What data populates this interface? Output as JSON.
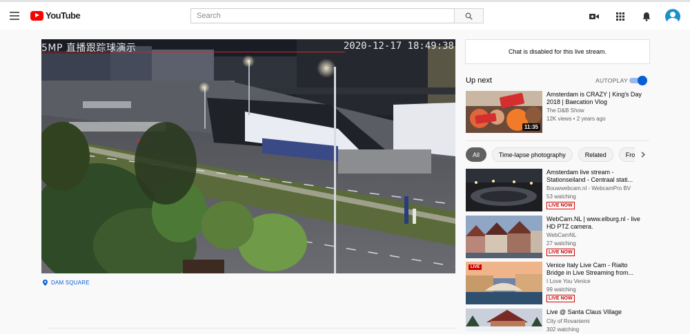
{
  "header": {
    "logo_text": "YouTube",
    "search_placeholder": "Search",
    "icons": [
      "menu-icon",
      "youtube-logo",
      "search-icon",
      "create-video-icon",
      "apps-grid-icon",
      "notifications-bell-icon",
      "account-avatar"
    ]
  },
  "player": {
    "osd_label": "5MP 直播跟踪球演示",
    "osd_timestamp": "2020-12-17 18:49:38"
  },
  "location": {
    "text": "DAM SQUARE",
    "icon": "location-pin-icon"
  },
  "sidebar": {
    "chat_disabled": "Chat is disabled for this live stream.",
    "up_next": "Up next",
    "autoplay": "AUTOPLAY",
    "autoplay_on": true,
    "up_next_video": {
      "title": "Amsterdam is CRAZY | King's Day 2018 | Baecation Vlog",
      "channel": "The D&B Show",
      "meta": "12K views • 2 years ago",
      "duration": "11:35"
    },
    "chips": [
      "All",
      "Time-lapse photography",
      "Related",
      "From The D&B Show"
    ],
    "videos": [
      {
        "title": "Amsterdam live stream - Stationseiland - Centraal stati...",
        "channel": "Bouwwebcam.nl - WebcamPro BV",
        "meta": "53 watching",
        "badge": "LIVE NOW"
      },
      {
        "title": "WebCam.NL | www.elburg.nl - live HD PTZ camera.",
        "channel": "WebCamNL",
        "meta": "27 watching",
        "badge": "LIVE NOW"
      },
      {
        "title": "Venice Italy Live Cam - Rialto Bridge in Live Streaming from...",
        "channel": "I Love You Venice",
        "meta": "99 watching",
        "badge": "LIVE NOW",
        "thumb_badge": "LIVE"
      },
      {
        "title": "Live @ Santa Claus Village",
        "channel": "City of Rovaniemi",
        "meta": "302 watching"
      }
    ]
  },
  "colors": {
    "accent": "#065fd4",
    "live": "#cc0000",
    "brand": "#ff0000"
  }
}
